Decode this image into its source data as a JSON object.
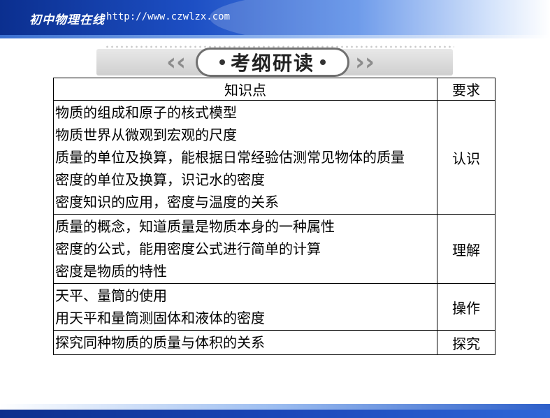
{
  "header": {
    "brand": "初中物理在线",
    "url": "http://www.czwlzx.com"
  },
  "title": {
    "text": "考纲研读"
  },
  "table": {
    "headers": [
      "知识点",
      "要求"
    ],
    "rows": [
      {
        "topics": [
          "物质的组成和原子的核式模型",
          "物质世界从微观到宏观的尺度",
          "质量的单位及换算，能根据日常经验估测常见物体的质量",
          "密度的单位及换算，识记水的密度",
          "密度知识的应用，密度与温度的关系"
        ],
        "requirement": "认识"
      },
      {
        "topics": [
          "质量的概念，知道质量是物质本身的一种属性",
          "密度的公式，能用密度公式进行简单的计算",
          "密度是物质的特性"
        ],
        "requirement": "理解"
      },
      {
        "topics": [
          "天平、量筒的使用",
          "用天平和量筒测固体和液体的密度"
        ],
        "requirement": "操作"
      },
      {
        "topics": [
          "探究同种物质的质量与体积的关系"
        ],
        "requirement": "探究"
      }
    ]
  }
}
